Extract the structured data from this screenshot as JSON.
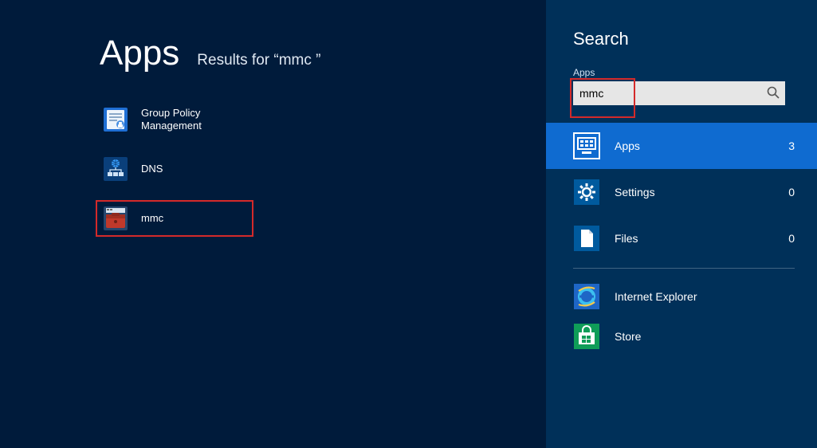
{
  "main": {
    "title": "Apps",
    "subtitle": "Results for “mmc ”"
  },
  "results": [
    {
      "label": "Group Policy Management",
      "icon": "gp-icon",
      "highlighted": false
    },
    {
      "label": "DNS",
      "icon": "dns-icon",
      "highlighted": false
    },
    {
      "label": "mmc",
      "icon": "mmc-icon",
      "highlighted": true
    }
  ],
  "search": {
    "panel_title": "Search",
    "scope_label": "Apps",
    "query": "mmc"
  },
  "filters": [
    {
      "label": "Apps",
      "count": 3,
      "icon": "apps-filter-icon",
      "active": true
    },
    {
      "label": "Settings",
      "count": 0,
      "icon": "settings-filter-icon",
      "active": false
    },
    {
      "label": "Files",
      "count": 0,
      "icon": "files-filter-icon",
      "active": false
    }
  ],
  "apps": [
    {
      "label": "Internet Explorer",
      "icon": "ie-icon"
    },
    {
      "label": "Store",
      "icon": "store-icon"
    }
  ]
}
